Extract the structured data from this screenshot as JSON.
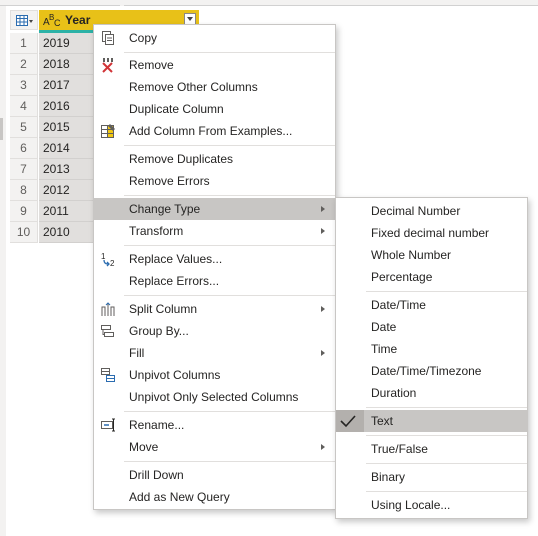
{
  "table": {
    "column_type": "A B C",
    "column_name": "Year",
    "rows": [
      {
        "num": "1",
        "value": "2019"
      },
      {
        "num": "2",
        "value": "2018"
      },
      {
        "num": "3",
        "value": "2017"
      },
      {
        "num": "4",
        "value": "2016"
      },
      {
        "num": "5",
        "value": "2015"
      },
      {
        "num": "6",
        "value": "2014"
      },
      {
        "num": "7",
        "value": "2013"
      },
      {
        "num": "8",
        "value": "2012"
      },
      {
        "num": "9",
        "value": "2011"
      },
      {
        "num": "10",
        "value": "2010"
      }
    ]
  },
  "context_menu": {
    "copy": "Copy",
    "remove": "Remove",
    "remove_other_columns": "Remove Other Columns",
    "duplicate_column": "Duplicate Column",
    "add_column_from_examples": "Add Column From Examples...",
    "remove_duplicates": "Remove Duplicates",
    "remove_errors": "Remove Errors",
    "change_type": "Change Type",
    "transform": "Transform",
    "replace_values": "Replace Values...",
    "replace_errors": "Replace Errors...",
    "split_column": "Split Column",
    "group_by": "Group By...",
    "fill": "Fill",
    "unpivot_columns": "Unpivot Columns",
    "unpivot_only_selected": "Unpivot Only Selected Columns",
    "rename": "Rename...",
    "move": "Move",
    "drill_down": "Drill Down",
    "add_as_new_query": "Add as New Query"
  },
  "change_type_menu": {
    "decimal_number": "Decimal Number",
    "fixed_decimal_number": "Fixed decimal number",
    "whole_number": "Whole Number",
    "percentage": "Percentage",
    "date_time": "Date/Time",
    "date": "Date",
    "time": "Time",
    "date_time_timezone": "Date/Time/Timezone",
    "duration": "Duration",
    "text": "Text",
    "true_false": "True/False",
    "binary": "Binary",
    "using_locale": "Using Locale..."
  },
  "selected_type": "Text",
  "colors": {
    "column_header": "#e8c118",
    "column_underline": "#2cb2a7",
    "highlight": "#c8c6c4",
    "remove_icon": "#d13438",
    "icon_blue": "#2b6cb0"
  }
}
